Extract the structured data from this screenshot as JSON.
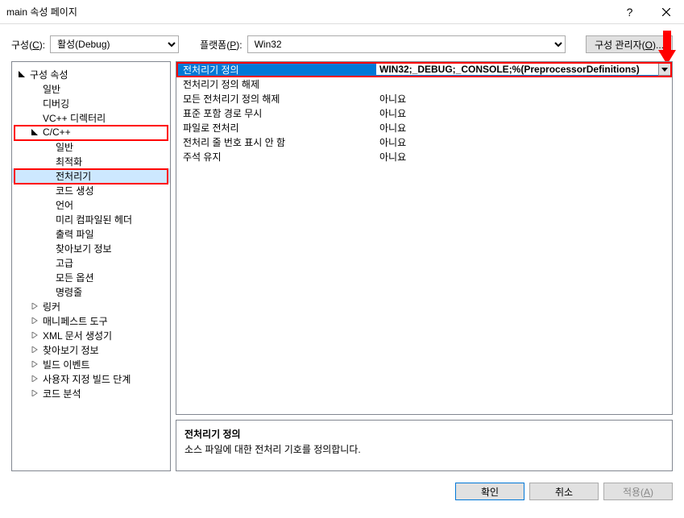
{
  "title": "main 속성 페이지",
  "toolbar": {
    "config_label": "구성(C):",
    "config_value": "활성(Debug)",
    "platform_label": "플랫폼(P):",
    "platform_value": "Win32",
    "manager_btn": "구성 관리자(O)..."
  },
  "tree": {
    "root": "구성 속성",
    "items_l1a": [
      "일반",
      "디버깅",
      "VC++ 디렉터리"
    ],
    "ccpp": "C/C++",
    "ccpp_items": [
      "일반",
      "최적화",
      "전처리기",
      "코드 생성",
      "언어",
      "미리 컴파일된 헤더",
      "출력 파일",
      "찾아보기 정보",
      "고급",
      "모든 옵션",
      "명령줄"
    ],
    "items_l1b": [
      "링커",
      "매니페스트 도구",
      "XML 문서 생성기",
      "찾아보기 정보",
      "빌드 이벤트",
      "사용자 지정 빌드 단계",
      "코드 분석"
    ]
  },
  "grid": {
    "rows": [
      {
        "name": "전처리기 정의",
        "value": "WIN32;_DEBUG;_CONSOLE;%(PreprocessorDefinitions)",
        "selected": true
      },
      {
        "name": "전처리기 정의 해제",
        "value": ""
      },
      {
        "name": "모든 전처리기 정의 해제",
        "value": "아니요"
      },
      {
        "name": "표준 포함 경로 무시",
        "value": "아니요"
      },
      {
        "name": "파일로 전처리",
        "value": "아니요"
      },
      {
        "name": "전처리 줄 번호 표시 안 함",
        "value": "아니요"
      },
      {
        "name": "주석 유지",
        "value": "아니요"
      }
    ]
  },
  "desc": {
    "title": "전처리기 정의",
    "text": "소스 파일에 대한 전처리 기호를 정의합니다."
  },
  "footer": {
    "ok": "확인",
    "cancel": "취소",
    "apply": "적용(A)"
  }
}
